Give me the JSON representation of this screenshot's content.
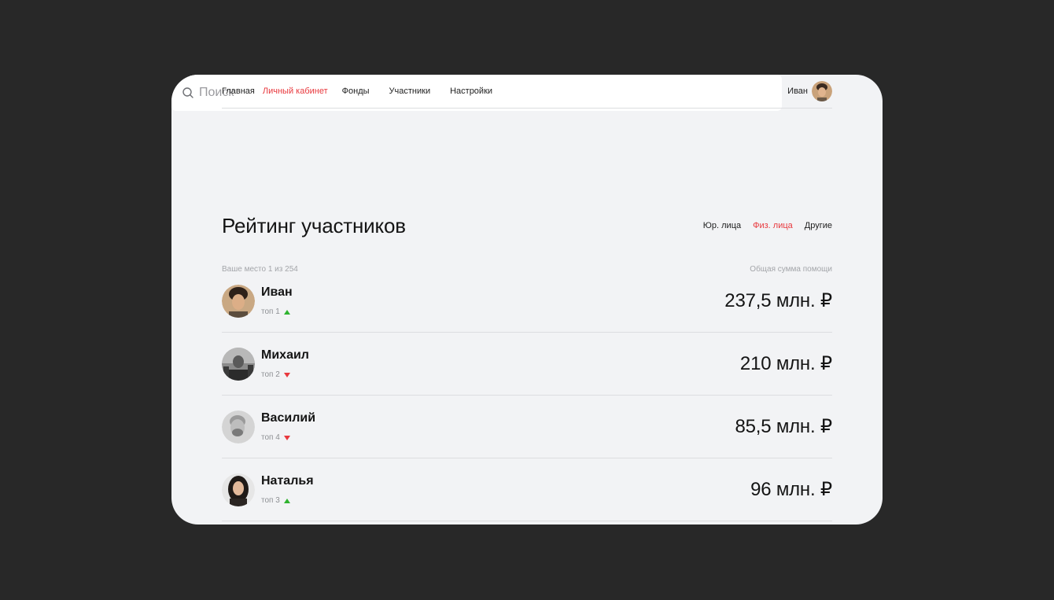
{
  "nav": {
    "items": [
      {
        "label": "Главная",
        "active": false
      },
      {
        "label": "Личный кабинет",
        "active": true
      },
      {
        "label": "Фонды",
        "active": false
      },
      {
        "label": "Участники",
        "active": false
      },
      {
        "label": "Настройки",
        "active": false
      }
    ],
    "user_name": "Иван"
  },
  "search": {
    "placeholder": "Поиск",
    "value": ""
  },
  "ranking": {
    "title": "Рейтинг участников",
    "filters": [
      {
        "label": "Юр. лица",
        "active": false
      },
      {
        "label": "Физ. лица",
        "active": true
      },
      {
        "label": "Другие",
        "active": false
      }
    ],
    "your_place": "Ваше место 1 из 254",
    "total_label": "Общая сумма помощи",
    "participants": [
      {
        "name": "Иван",
        "rank": "топ 1",
        "trend": "up",
        "amount": "237,5 млн. ₽"
      },
      {
        "name": "Михаил",
        "rank": "топ 2",
        "trend": "down",
        "amount": "210 млн. ₽"
      },
      {
        "name": "Василий",
        "rank": "топ 4",
        "trend": "down",
        "amount": "85,5 млн. ₽"
      },
      {
        "name": "Наталья",
        "rank": "топ 3",
        "trend": "up",
        "amount": "96 млн. ₽"
      }
    ]
  },
  "colors": {
    "accent": "#e8383d",
    "trend_up": "#2fb32f",
    "trend_down": "#e8383d",
    "card_bg": "#f2f3f5",
    "page_bg": "#282828"
  },
  "icons": {
    "search": "search-icon",
    "avatar": "user-avatar"
  }
}
